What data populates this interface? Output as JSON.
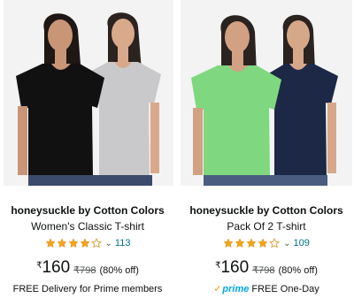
{
  "products": [
    {
      "brand": "honeysuckle by Cotton Colors",
      "title": "Women's Classic T-shirt",
      "rating": 4.0,
      "review_count": "113",
      "currency_symbol": "₹",
      "price": "160",
      "mrp": "₹798",
      "discount": "(80% off)",
      "delivery": "FREE Delivery for Prime members",
      "shirts": [
        "#111111",
        "#c9c9cb"
      ]
    },
    {
      "brand": "honeysuckle by Cotton Colors",
      "title": "Pack Of 2 T-shirt",
      "rating": 4.0,
      "review_count": "109",
      "currency_symbol": "₹",
      "price": "160",
      "mrp": "₹798",
      "discount": "(80% off)",
      "prime_label": "prime",
      "prime_delivery": "FREE One-Day",
      "shirts": [
        "#7fd87f",
        "#1c2846"
      ]
    }
  ],
  "colors": {
    "link": "#007185",
    "star": "#f4a41d",
    "prime": "#00a8e1",
    "prime_check": "#ff9900"
  }
}
